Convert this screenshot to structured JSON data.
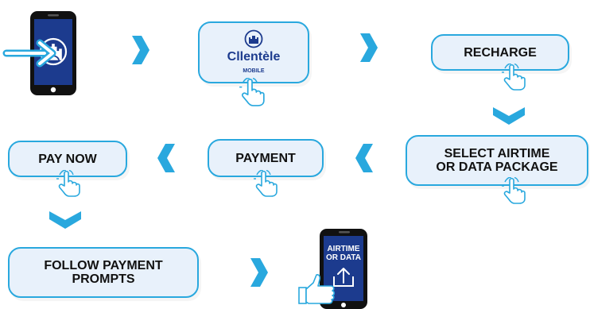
{
  "colors": {
    "accent": "#29a8de",
    "phone_body": "#111111",
    "phone_screen": "#1c3b8e",
    "box_fill": "#e8f1fb",
    "text": "#111111"
  },
  "steps": {
    "clientele_app": {
      "brand": "Cllentèle",
      "sub": "MOBILE"
    },
    "recharge": {
      "label": "RECHARGE"
    },
    "select_package": {
      "line1": "SELECT AIRTIME",
      "line2": "OR DATA PACKAGE"
    },
    "payment": {
      "label": "PAYMENT"
    },
    "pay_now": {
      "label": "PAY NOW"
    },
    "follow_prompts": {
      "line1": "FOLLOW PAYMENT",
      "line2": "PROMPTS"
    },
    "final_phone": {
      "line1": "AIRTIME",
      "line2": "OR DATA"
    }
  },
  "icons": {
    "open_app": "phone-with-arrow-icon",
    "tap": "tap-hand-icon",
    "chevron": "chevron-icon",
    "thumbs_up": "thumbs-up-icon",
    "upload": "upload-arrow-icon"
  }
}
